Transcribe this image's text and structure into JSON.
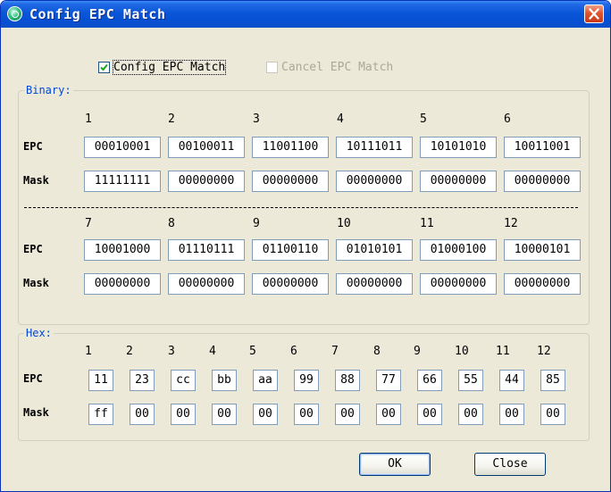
{
  "window": {
    "title": "Config EPC Match"
  },
  "options": {
    "config_label": "Config EPC Match",
    "config_checked": true,
    "cancel_label": "Cancel EPC Match",
    "cancel_checked": false
  },
  "binary": {
    "title": "Binary:",
    "row_labels": {
      "epc": "EPC",
      "mask": "Mask"
    },
    "columns_top": [
      "1",
      "2",
      "3",
      "4",
      "5",
      "6"
    ],
    "epc_top": [
      "00010001",
      "00100011",
      "11001100",
      "10111011",
      "10101010",
      "10011001"
    ],
    "mask_top": [
      "11111111",
      "00000000",
      "00000000",
      "00000000",
      "00000000",
      "00000000"
    ],
    "separator": "------------------------------------------------------------",
    "columns_bottom": [
      "7",
      "8",
      "9",
      "10",
      "11",
      "12"
    ],
    "epc_bottom": [
      "10001000",
      "01110111",
      "01100110",
      "01010101",
      "01000100",
      "10000101"
    ],
    "mask_bottom": [
      "00000000",
      "00000000",
      "00000000",
      "00000000",
      "00000000",
      "00000000"
    ]
  },
  "hex": {
    "title": "Hex:",
    "row_labels": {
      "epc": "EPC",
      "mask": "Mask"
    },
    "columns": [
      "1",
      "2",
      "3",
      "4",
      "5",
      "6",
      "7",
      "8",
      "9",
      "10",
      "11",
      "12"
    ],
    "epc": [
      "11",
      "23",
      "cc",
      "bb",
      "aa",
      "99",
      "88",
      "77",
      "66",
      "55",
      "44",
      "85"
    ],
    "mask": [
      "ff",
      "00",
      "00",
      "00",
      "00",
      "00",
      "00",
      "00",
      "00",
      "00",
      "00",
      "00"
    ]
  },
  "buttons": {
    "ok": "OK",
    "close": "Close"
  },
  "colors": {
    "title_bar": "#0a56d8",
    "group_title": "#0046d5",
    "field_border": "#7f9db9",
    "checkmark": "#21a121"
  }
}
